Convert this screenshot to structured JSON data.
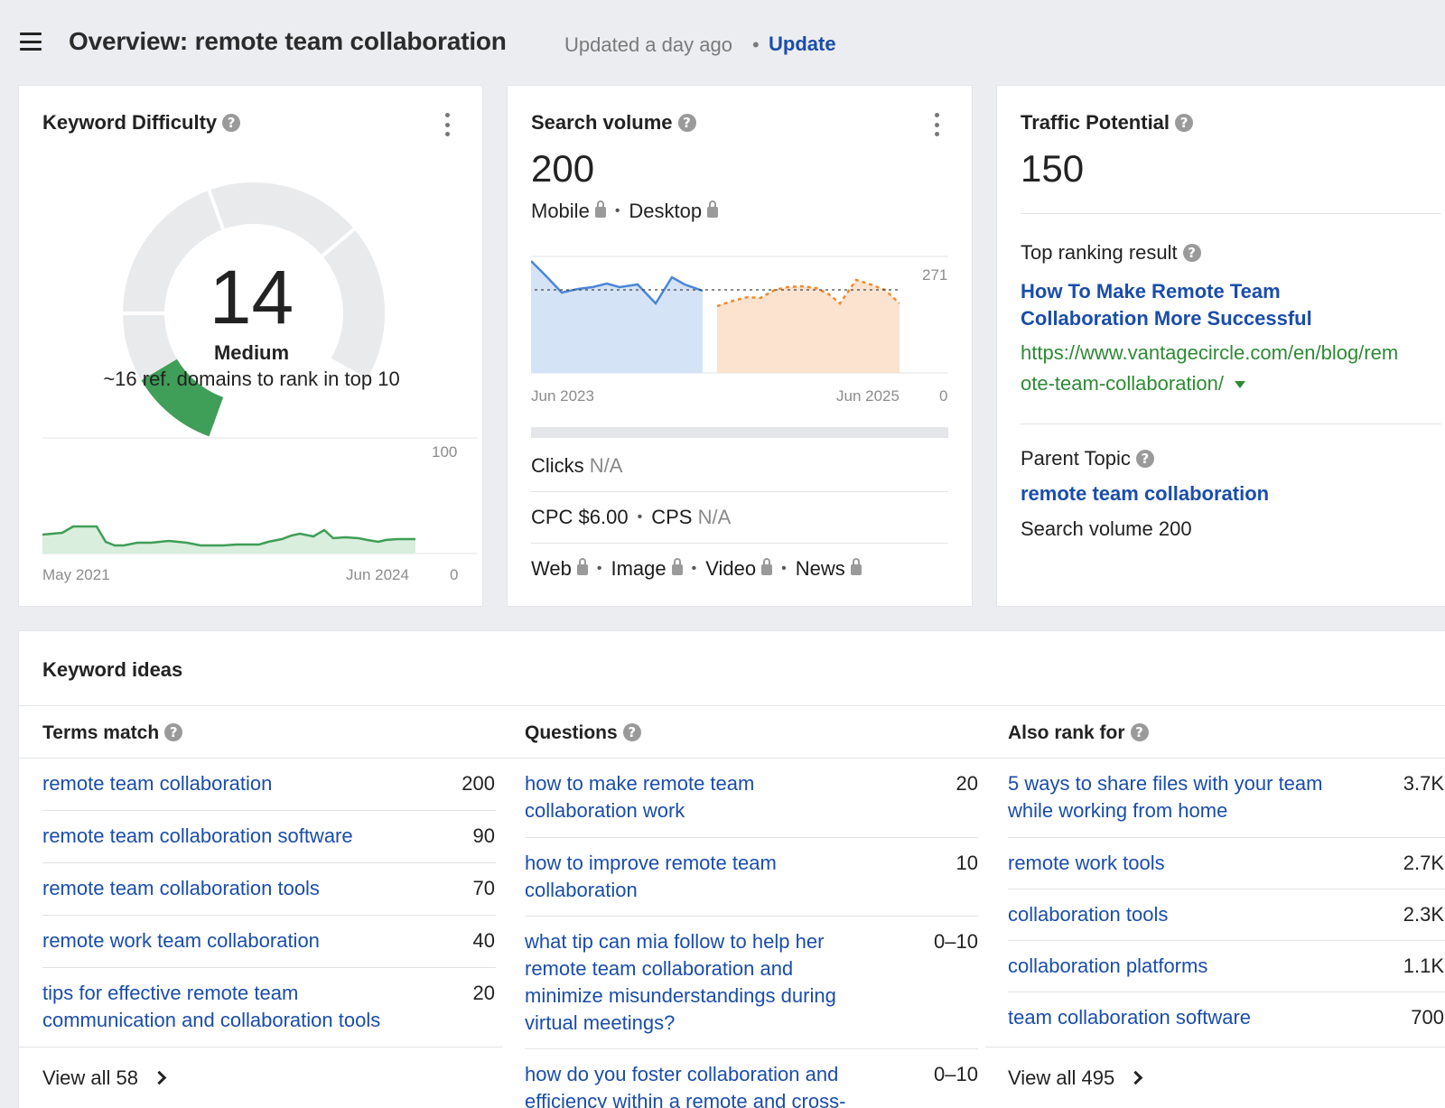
{
  "header": {
    "title": "Overview: remote team collaboration",
    "updated": "Updated a day ago",
    "dot": "•",
    "update_label": "Update"
  },
  "difficulty": {
    "title": "Keyword Difficulty",
    "score": "14",
    "score_value": 14,
    "level": "Medium",
    "note": "~16 ref. domains to rank in top 10",
    "axis_max": "100",
    "axis_min": "0",
    "x_start": "May 2021",
    "x_end": "Jun 2024",
    "accent": "#3f9e57"
  },
  "volume": {
    "title": "Search volume",
    "value": "200",
    "mobile": "Mobile",
    "desktop": "Desktop",
    "axis_max": "271",
    "axis_min": "0",
    "x_start": "Jun 2023",
    "x_end": "Jun 2025",
    "clicks_label": "Clicks",
    "clicks_value": "N/A",
    "cpc_label": "CPC $6.00",
    "cps_label": "CPS",
    "cps_value": "N/A",
    "serp": [
      "Web",
      "Image",
      "Video",
      "News"
    ]
  },
  "traffic": {
    "title": "Traffic Potential",
    "value": "150",
    "top_label": "Top ranking result",
    "top_title_1": "How To Make Remote Team",
    "top_title_2": "Collaboration More Successful",
    "top_url_1": "https://www.vantagecircle.com/en/blog/rem",
    "top_url_2": "ote-team-collaboration/",
    "parent_label": "Parent Topic",
    "parent_topic": "remote team collaboration",
    "parent_volume": "Search volume 200"
  },
  "ideas": {
    "title": "Keyword ideas",
    "terms": {
      "title": "Terms match",
      "rows": [
        {
          "l1": "remote team collaboration",
          "l2": "",
          "n": "200"
        },
        {
          "l1": "remote team collaboration software",
          "l2": "",
          "n": "90"
        },
        {
          "l1": "remote team collaboration tools",
          "l2": "",
          "n": "70"
        },
        {
          "l1": "remote work team collaboration",
          "l2": "",
          "n": "40"
        },
        {
          "l1": "tips for effective remote team",
          "l2": "communication and collaboration tools",
          "n": "20"
        }
      ],
      "view_all": "View all 58"
    },
    "questions": {
      "title": "Questions",
      "rows": [
        {
          "l1": "how to make remote team",
          "l2": "collaboration work",
          "l3": "",
          "l4": "",
          "n": "20"
        },
        {
          "l1": "how to improve remote team",
          "l2": "collaboration",
          "l3": "",
          "l4": "",
          "n": "10"
        },
        {
          "l1": "what tip can mia follow to help her",
          "l2": "remote team collaboration and",
          "l3": "minimize misunderstandings during",
          "l4": "virtual meetings?",
          "n": "0–10"
        },
        {
          "l1": "how do you foster collaboration and",
          "l2": "efficiency within a remote and cross-",
          "l3": "",
          "l4": "",
          "n": "0–10"
        }
      ]
    },
    "also": {
      "title": "Also rank for",
      "rows": [
        {
          "l1": "5 ways to share files with your team",
          "l2": "while working from home",
          "n": "3.7K"
        },
        {
          "l1": "remote work tools",
          "l2": "",
          "n": "2.7K"
        },
        {
          "l1": "collaboration tools",
          "l2": "",
          "n": "2.3K"
        },
        {
          "l1": "collaboration platforms",
          "l2": "",
          "n": "1.1K"
        },
        {
          "l1": "team collaboration software",
          "l2": "",
          "n": "700"
        }
      ],
      "view_all": "View all 495"
    }
  }
}
